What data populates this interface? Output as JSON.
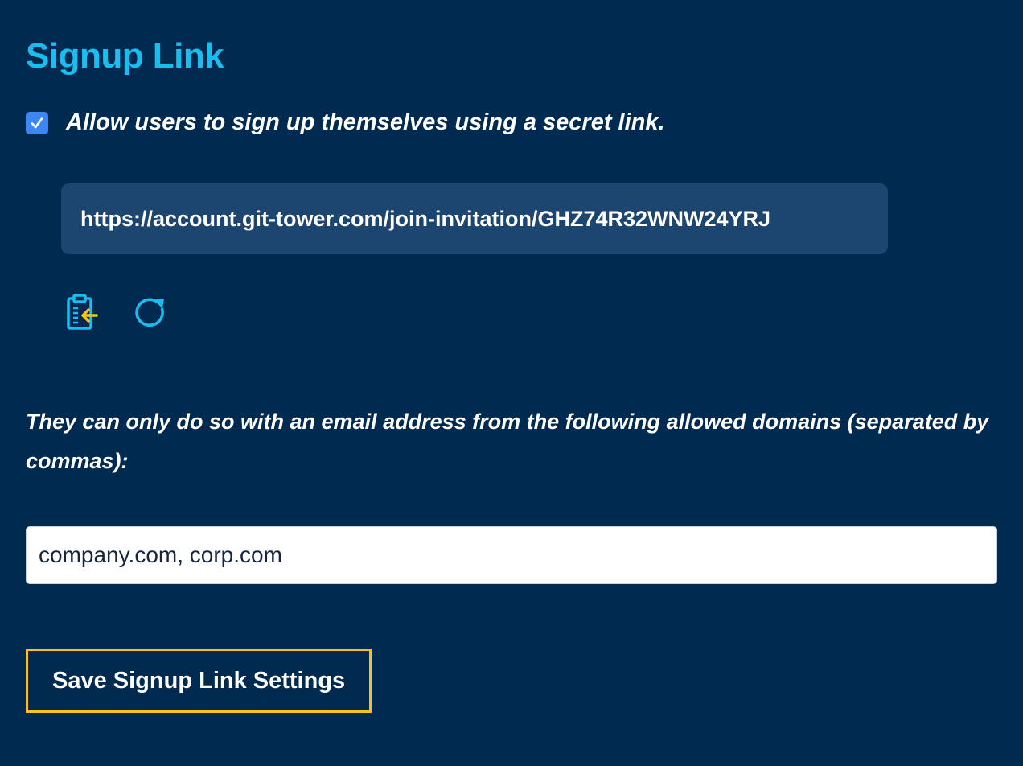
{
  "section": {
    "title": "Signup Link"
  },
  "allow_signup": {
    "checked": true,
    "label": "Allow users to sign up themselves using a secret link."
  },
  "signup_link": {
    "url": "https://account.git-tower.com/join-invitation/GHZ74R32WNW24YRJ"
  },
  "actions": {
    "copy_icon": "clipboard-paste-icon",
    "regenerate_icon": "refresh-icon"
  },
  "domains": {
    "label": "They can only do so with an email address from the following allowed domains (separated by commas):",
    "value": "company.com, corp.com"
  },
  "save_button": {
    "label": "Save Signup Link Settings"
  },
  "colors": {
    "background": "#002a4f",
    "title": "#19bdf0",
    "checkbox": "#3d87f5",
    "link_box": "#1c4670",
    "icon": "#19bdf0",
    "button_border": "#f7c21a"
  }
}
